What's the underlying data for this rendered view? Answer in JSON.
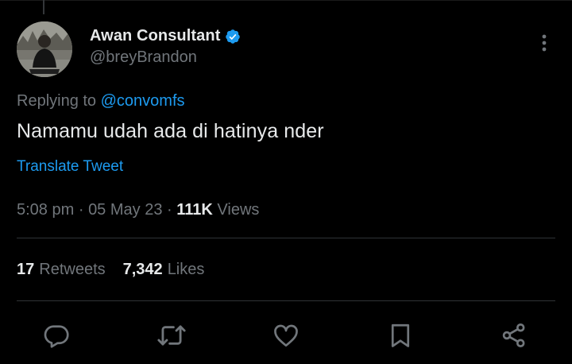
{
  "author": {
    "display_name": "Awan Consultant",
    "handle": "@breyBrandon",
    "verified": true
  },
  "reply_context": {
    "prefix": "Replying to",
    "mention": "@convomfs"
  },
  "tweet": {
    "text": "Namamu udah ada di hatinya nder",
    "translate_label": "Translate Tweet"
  },
  "meta": {
    "time": "5:08 pm",
    "separator": "·",
    "date": "05 May 23",
    "views_count": "111K",
    "views_label": "Views"
  },
  "stats": {
    "retweets_count": "17",
    "retweets_label": "Retweets",
    "likes_count": "7,342",
    "likes_label": "Likes"
  },
  "actions": [
    "reply-icon",
    "retweet-icon",
    "like-icon",
    "bookmark-icon",
    "share-icon"
  ],
  "colors": {
    "background": "#000000",
    "primary_text": "#e7e9ea",
    "secondary_text": "#71767b",
    "link": "#1d9bf0",
    "divider": "#2f3336"
  }
}
